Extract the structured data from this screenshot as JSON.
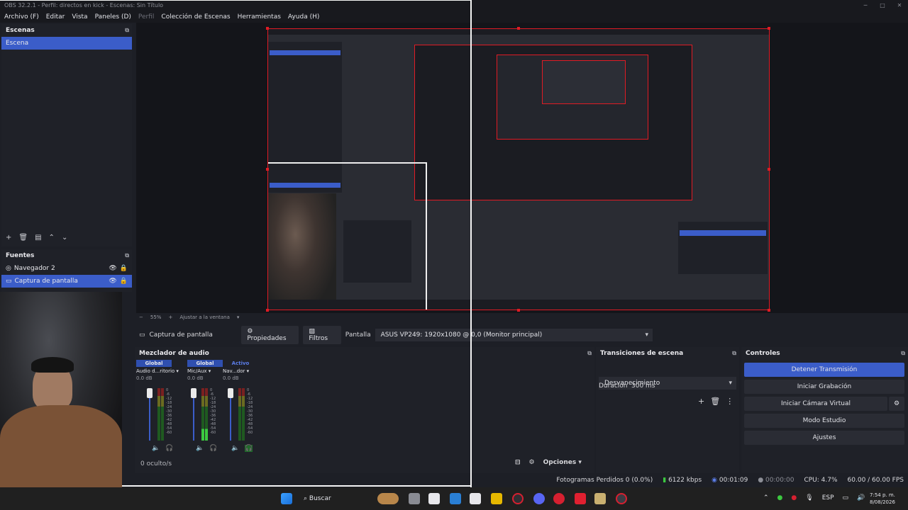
{
  "window": {
    "title": "OBS 32.2.1 - Perfil: directos en kick - Escenas: Sin Título"
  },
  "menu": [
    {
      "label": "Archivo (F)",
      "dim": false
    },
    {
      "label": "Editar",
      "dim": false
    },
    {
      "label": "Vista",
      "dim": false
    },
    {
      "label": "Paneles (D)",
      "dim": false
    },
    {
      "label": "Perfil",
      "dim": true
    },
    {
      "label": "Colección de Escenas",
      "dim": false
    },
    {
      "label": "Herramientas",
      "dim": false
    },
    {
      "label": "Ayuda (H)",
      "dim": false
    }
  ],
  "scenes": {
    "title": "Escenas",
    "items": [
      "Escena"
    ]
  },
  "sources": {
    "title": "Fuentes",
    "items": [
      {
        "label": "Navegador 2",
        "icon": "globe-icon"
      },
      {
        "label": "Captura de pantalla",
        "icon": "monitor-icon"
      }
    ]
  },
  "preview": {
    "zoom": "55%",
    "fit_label": "Ajustar a la ventana"
  },
  "source_toolbar": {
    "source_name": "Captura de pantalla",
    "properties": "Propiedades",
    "filters": "Filtros",
    "display_label": "Pantalla",
    "display_value": "ASUS VP249: 1920x1080 @ 0,0 (Monitor principal)"
  },
  "mixer": {
    "title": "Mezclador de audio",
    "channels": [
      {
        "head": "Global",
        "name": "Audio d...ritorio",
        "db": "0.0 dB",
        "active": false
      },
      {
        "head": "Global",
        "name": "Mic/Aux",
        "db": "0.0 dB",
        "active": false
      },
      {
        "head": "Activo",
        "name": "Nav...dor",
        "db": "0.0 dB",
        "active": true
      }
    ],
    "scale": [
      "0",
      "-6",
      "-12",
      "-18",
      "-24",
      "-30",
      "-36",
      "-42",
      "-48",
      "-54",
      "-60"
    ],
    "hidden": "0 oculto/s",
    "options": "Opciones"
  },
  "transitions": {
    "title": "Transiciones de escena",
    "selected": "Desvanecimiento",
    "duration_label": "Duración",
    "duration_value": "300 ms"
  },
  "controls": {
    "title": "Controles",
    "buttons": [
      "Detener Transmisión",
      "Iniciar Grabación",
      "Iniciar Cámara Virtual",
      "Modo Estudio",
      "Ajustes"
    ]
  },
  "status": {
    "dropped": "Fotogramas Perdidos 0 (0.0%)",
    "bitrate": "6122 kbps",
    "stream_time": "00:01:09",
    "rec_time": "00:00:00",
    "cpu": "CPU: 4.7%",
    "fps": "60.00 / 60.00 FPS"
  },
  "taskbar": {
    "search": "Buscar",
    "lang": "ESP",
    "time": "7:54 p. m.",
    "date": "8/08/2026"
  },
  "colors": {
    "accent": "#3b5dc9",
    "border_red": "#e01b24",
    "dock_bg": "#1f2128"
  }
}
